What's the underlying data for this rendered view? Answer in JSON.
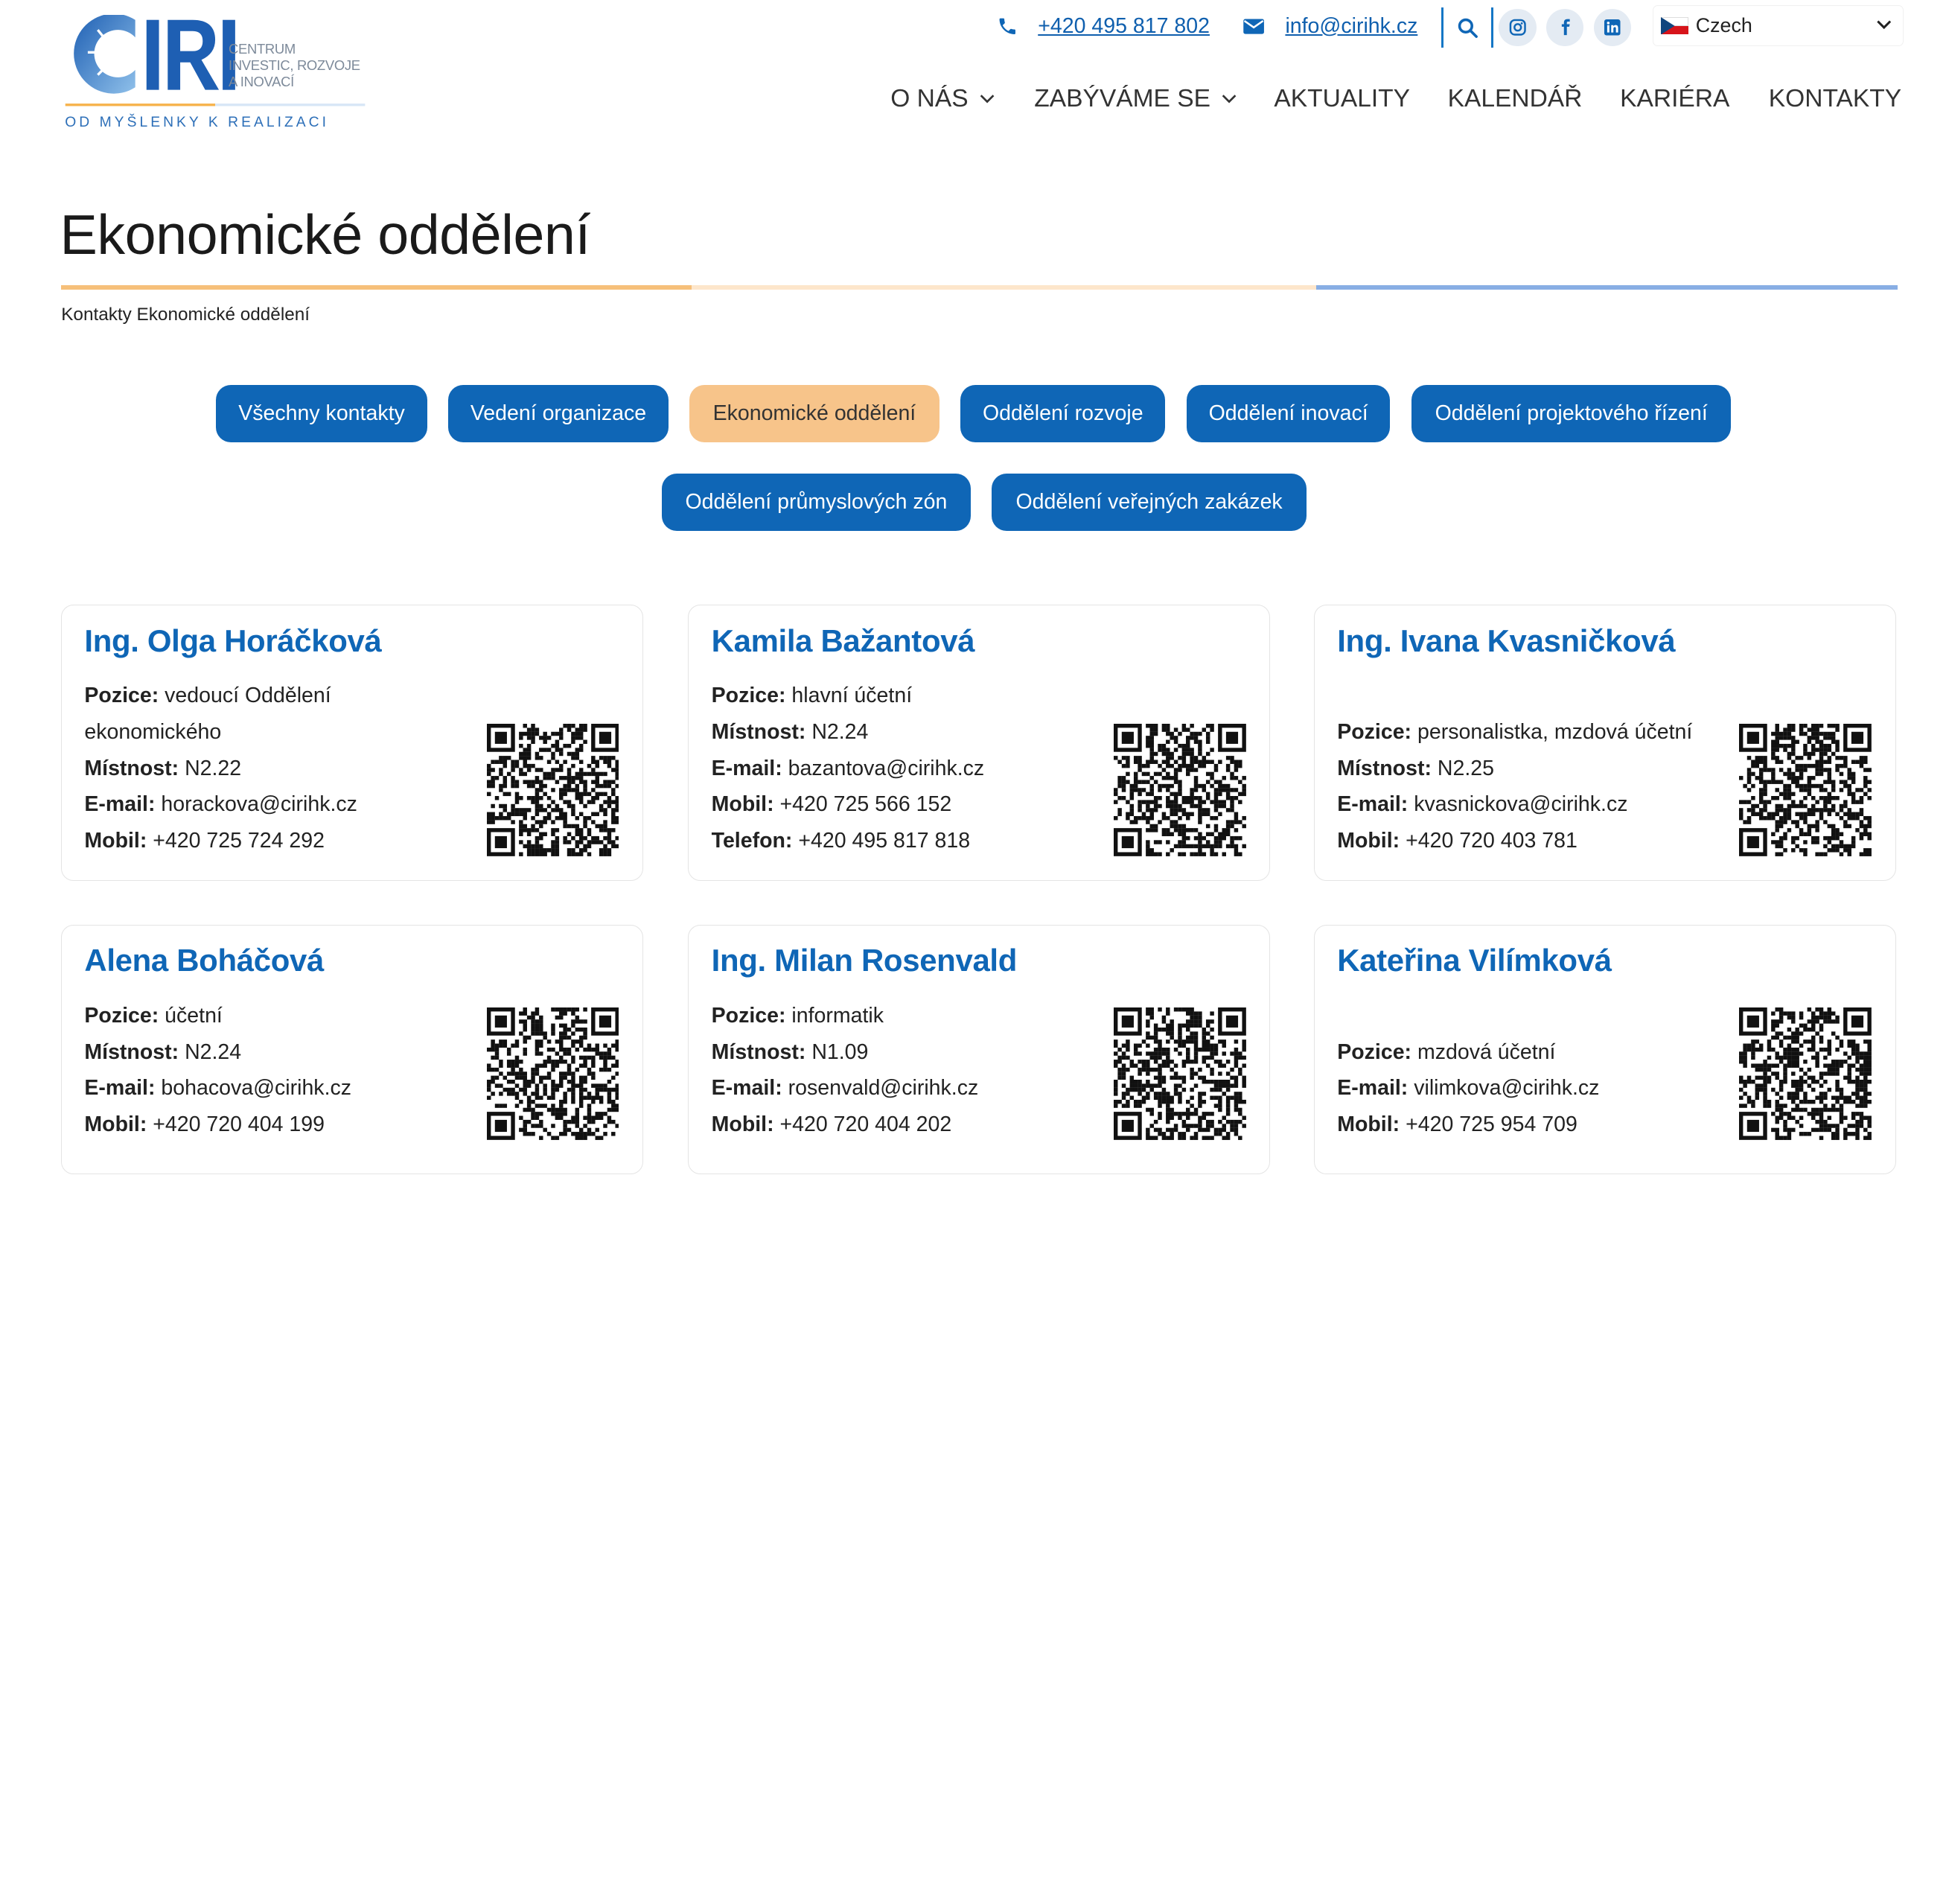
{
  "logo": {
    "letters": "CIRI",
    "sub": [
      "CENTRUM",
      "INVESTIC, ROZVOJE",
      "A INOVACÍ"
    ],
    "tagline": "OD MYŠLENKY K REALIZACI"
  },
  "topbar": {
    "phone": "+420 495 817 802",
    "email": "info@cirihk.cz",
    "language": "Czech"
  },
  "nav": {
    "items": [
      {
        "label": "O NÁS"
      },
      {
        "label": "ZABÝVÁME SE"
      },
      {
        "label": "AKTUALITY"
      },
      {
        "label": "KALENDÁŘ"
      },
      {
        "label": "KARIÉRA"
      },
      {
        "label": "KONTAKTY"
      }
    ]
  },
  "page": {
    "title": "Ekonomické oddělení",
    "breadcrumb": "Kontakty Ekonomické oddělení"
  },
  "filters": [
    {
      "label": "Všechny kontakty"
    },
    {
      "label": "Vedení organizace"
    },
    {
      "label": "Ekonomické oddělení",
      "active": true
    },
    {
      "label": "Oddělení rozvoje"
    },
    {
      "label": "Oddělení inovací"
    },
    {
      "label": "Oddělení projektového řízení"
    },
    {
      "label": "Oddělení průmyslových zón"
    },
    {
      "label": "Oddělení veřejných zakázek"
    }
  ],
  "labels": {
    "pozice": "Pozice:",
    "mistnost": "Místnost:",
    "email": "E-mail:",
    "mobil": "Mobil:",
    "telefon": "Telefon:"
  },
  "contacts": [
    {
      "name": "Ing. Olga Horáčková",
      "pozice_1": "vedoucí Oddělení",
      "pozice_2": "ekonomického",
      "mistnost": "N2.22",
      "email": "horackova@cirihk.cz",
      "mobil": "+420 725 724 292"
    },
    {
      "name": "Kamila Bažantová",
      "pozice": "hlavní účetní",
      "mistnost": "N2.24",
      "email": "bazantova@cirihk.cz",
      "mobil": "+420 725 566 152",
      "telefon": "+420 495 817 818"
    },
    {
      "name": "Ing. Ivana Kvasničková",
      "pozice": "personalistka, mzdová účetní",
      "mistnost": "N2.25",
      "email": "kvasnickova@cirihk.cz",
      "mobil": "+420 720 403 781"
    },
    {
      "name": "Alena Boháčová",
      "pozice": "účetní",
      "mistnost": "N2.24",
      "email": "bohacova@cirihk.cz",
      "mobil": "+420 720 404 199"
    },
    {
      "name": "Ing. Milan Rosenvald",
      "pozice": "informatik",
      "mistnost": "N1.09",
      "email": "rosenvald@cirihk.cz",
      "mobil": "+420 720 404 202"
    },
    {
      "name": "Kateřina Vilímková",
      "pozice": "mzdová účetní",
      "email": "vilimkova@cirihk.cz",
      "mobil": "+420 725 954 709"
    }
  ],
  "colors": {
    "brand_blue": "#0f66b6",
    "active_orange": "#f7c48a",
    "accent_line_orange": "#f6c07a",
    "accent_line_blue": "#88aee4"
  }
}
